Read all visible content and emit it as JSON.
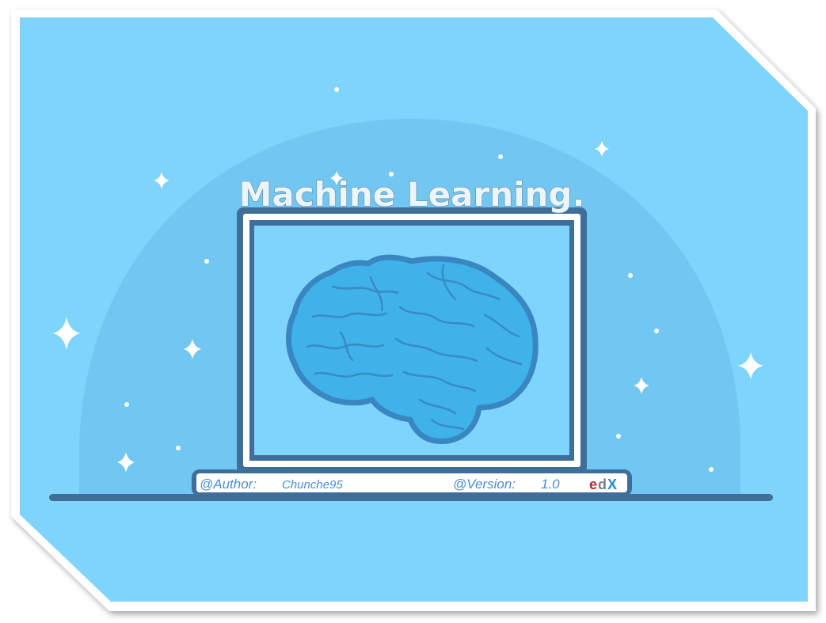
{
  "title": "Machine Learning.",
  "footer": {
    "author_label": "@Author:",
    "author_name": "Chunche95",
    "version_label": "@Version:",
    "version_value": "1.0",
    "logo": {
      "part_e": "e",
      "part_d": "d",
      "part_x": "X"
    }
  },
  "colors": {
    "background": "#7fd4fb",
    "dome": "#6ec3f0",
    "frame": "#3f6e9a",
    "screen": "#7fd4fb",
    "brain": "#3fb2ea",
    "brain_outline": "#3a86c0",
    "star": "#ffffff"
  },
  "icons": {
    "brain": "brain-icon",
    "laptop": "laptop-icon",
    "stars": "sparkle-icon"
  }
}
